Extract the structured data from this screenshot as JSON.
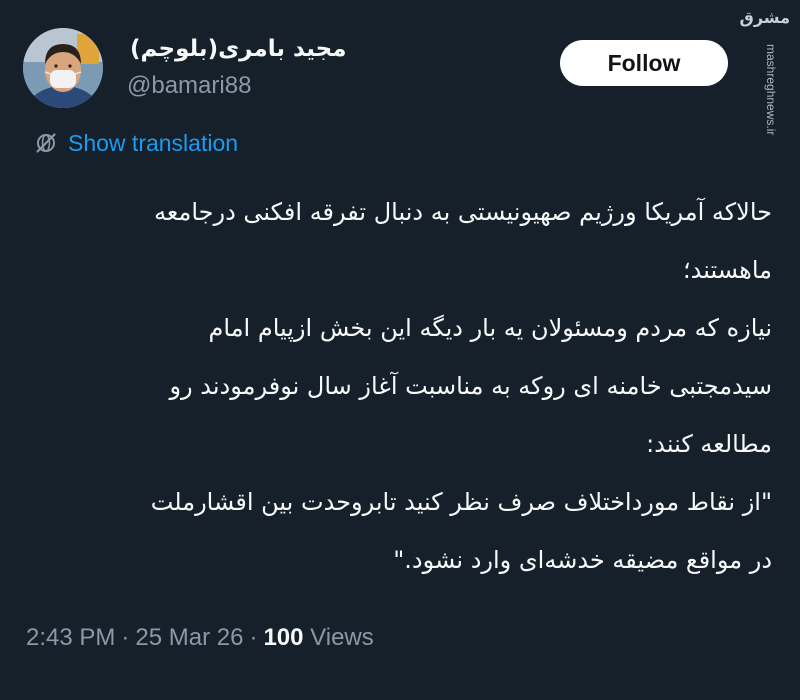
{
  "author": {
    "display_name": "مجید بامری(بلوچم)",
    "handle": "@bamari88"
  },
  "follow_label": "Follow",
  "watermark": {
    "logo": "مشرق",
    "site": "mashreghnews.ir"
  },
  "translation_label": "Show translation",
  "tweet_lines": [
    "حالاکه آمریکا ورژیم صهیونیستی به دنبال تفرقه افکنی درجامعه",
    "ماهستند؛",
    "نیازه که مردم ومسئولان یه بار دیگه این بخش ازپیام امام",
    "سیدمجتبی خامنه ای روکه به مناسبت آغاز سال نوفرمودند رو",
    "مطالعه کنند:",
    "\"از نقاط مورداختلاف صرف نظر کنید تابروحدت بین اقشارملت",
    "در مواقع مضیقه خدشه‌ای وارد نشود.\""
  ],
  "meta": {
    "time": "2:43 PM",
    "date": "25 Mar 26",
    "separator": "·",
    "views_count": "100",
    "views_label": "Views"
  },
  "colors": {
    "background": "#15202b",
    "link": "#1d9bf0",
    "secondary_text": "#8b98a5"
  },
  "icons": {
    "translate": "translate-globe-slash-icon"
  }
}
